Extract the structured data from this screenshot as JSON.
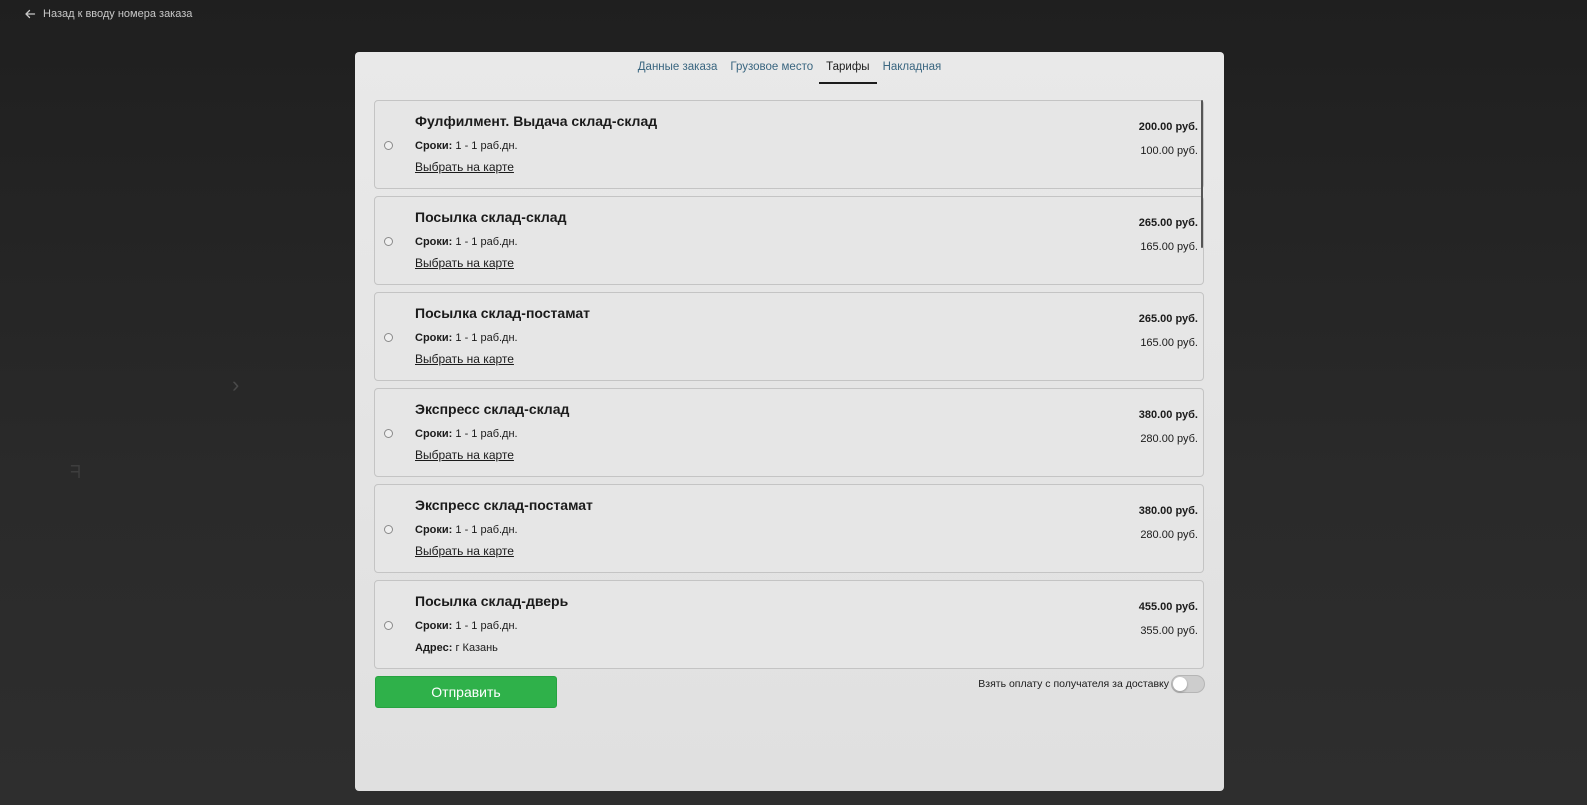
{
  "nav": {
    "back_label": "Назад к вводу номера заказа",
    "back_icon": "arrow-left-icon"
  },
  "tabs": [
    {
      "label": "Данные заказа",
      "active": false
    },
    {
      "label": "Грузовое место",
      "active": false
    },
    {
      "label": "Тарифы",
      "active": true
    },
    {
      "label": "Накладная",
      "active": false
    }
  ],
  "tariffs": [
    {
      "title": "Фулфилмент. Выдача склад-склад",
      "terms_label": "Сроки:",
      "terms_value": "1 - 1 раб.дн.",
      "link": "Выбрать на карте",
      "price_main": "200.00 руб.",
      "price_secondary": "100.00 руб."
    },
    {
      "title": "Посылка склад-склад",
      "terms_label": "Сроки:",
      "terms_value": "1 - 1 раб.дн.",
      "link": "Выбрать на карте",
      "price_main": "265.00 руб.",
      "price_secondary": "165.00 руб."
    },
    {
      "title": "Посылка склад-постамат",
      "terms_label": "Сроки:",
      "terms_value": "1 - 1 раб.дн.",
      "link": "Выбрать на карте",
      "price_main": "265.00 руб.",
      "price_secondary": "165.00 руб."
    },
    {
      "title": "Экспресс склад-склад",
      "terms_label": "Сроки:",
      "terms_value": "1 - 1 раб.дн.",
      "link": "Выбрать на карте",
      "price_main": "380.00 руб.",
      "price_secondary": "280.00 руб."
    },
    {
      "title": "Экспресс склад-постамат",
      "terms_label": "Сроки:",
      "terms_value": "1 - 1 раб.дн.",
      "link": "Выбрать на карте",
      "price_main": "380.00 руб.",
      "price_secondary": "280.00 руб."
    },
    {
      "title": "Посылка склад-дверь",
      "terms_label": "Сроки:",
      "terms_value": "1 - 1 раб.дн.",
      "address_label": "Адрес:",
      "address_value": "г Казань",
      "price_main": "455.00 руб.",
      "price_secondary": "355.00 руб."
    }
  ],
  "footer": {
    "submit_label": "Отправить",
    "toggle_label": "Взять оплату с получателя за доставку",
    "toggle_on": false
  },
  "colors": {
    "accent": "#2fb14a",
    "tab_link": "#3a6680",
    "background": "#262626"
  }
}
